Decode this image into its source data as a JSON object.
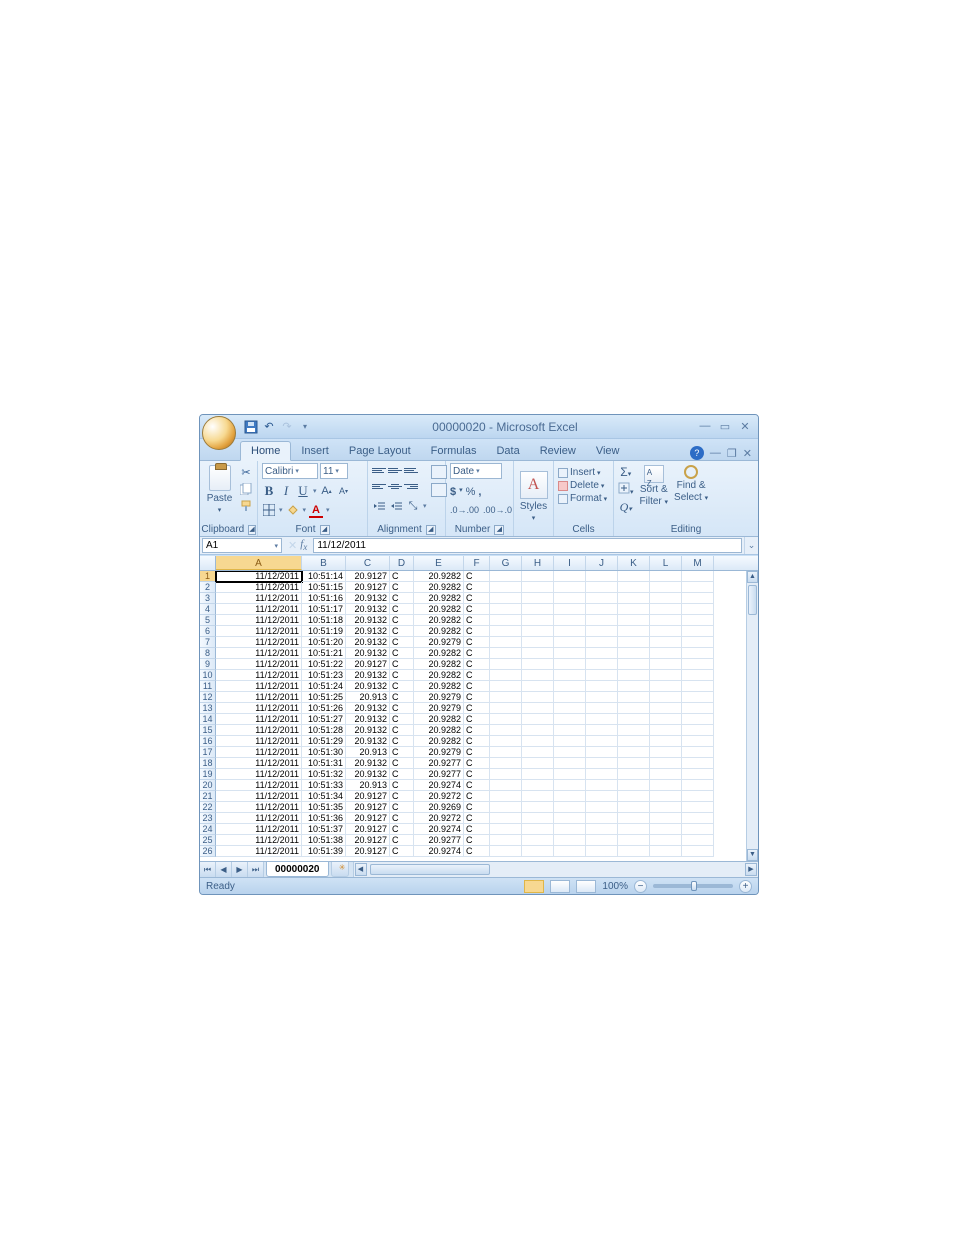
{
  "title": "00000020 - Microsoft Excel",
  "tabs": [
    "Home",
    "Insert",
    "Page Layout",
    "Formulas",
    "Data",
    "Review",
    "View"
  ],
  "activeTab": "Home",
  "ribbon": {
    "clipboard": {
      "label": "Clipboard",
      "paste": "Paste"
    },
    "font": {
      "label": "Font",
      "name": "Calibri",
      "size": "11"
    },
    "alignment": {
      "label": "Alignment"
    },
    "number": {
      "label": "Number",
      "format": "Date"
    },
    "styles": {
      "label": "Styles"
    },
    "cells": {
      "label": "Cells",
      "insert": "Insert",
      "delete": "Delete",
      "format": "Format"
    },
    "editing": {
      "label": "Editing",
      "sort": "Sort &",
      "filter": "Filter",
      "find": "Find &",
      "select": "Select"
    }
  },
  "nameBox": "A1",
  "formulaBar": "11/12/2011",
  "columns": [
    "A",
    "B",
    "C",
    "D",
    "E",
    "F",
    "G",
    "H",
    "I",
    "J",
    "K",
    "L",
    "M"
  ],
  "selectedColumn": "A",
  "rows": [
    {
      "n": 1,
      "a": "11/12/2011",
      "b": "10:51:14",
      "c": "20.9127",
      "d": "C",
      "e": "20.9282",
      "f": "C"
    },
    {
      "n": 2,
      "a": "11/12/2011",
      "b": "10:51:15",
      "c": "20.9127",
      "d": "C",
      "e": "20.9282",
      "f": "C"
    },
    {
      "n": 3,
      "a": "11/12/2011",
      "b": "10:51:16",
      "c": "20.9132",
      "d": "C",
      "e": "20.9282",
      "f": "C"
    },
    {
      "n": 4,
      "a": "11/12/2011",
      "b": "10:51:17",
      "c": "20.9132",
      "d": "C",
      "e": "20.9282",
      "f": "C"
    },
    {
      "n": 5,
      "a": "11/12/2011",
      "b": "10:51:18",
      "c": "20.9132",
      "d": "C",
      "e": "20.9282",
      "f": "C"
    },
    {
      "n": 6,
      "a": "11/12/2011",
      "b": "10:51:19",
      "c": "20.9132",
      "d": "C",
      "e": "20.9282",
      "f": "C"
    },
    {
      "n": 7,
      "a": "11/12/2011",
      "b": "10:51:20",
      "c": "20.9132",
      "d": "C",
      "e": "20.9279",
      "f": "C"
    },
    {
      "n": 8,
      "a": "11/12/2011",
      "b": "10:51:21",
      "c": "20.9132",
      "d": "C",
      "e": "20.9282",
      "f": "C"
    },
    {
      "n": 9,
      "a": "11/12/2011",
      "b": "10:51:22",
      "c": "20.9127",
      "d": "C",
      "e": "20.9282",
      "f": "C"
    },
    {
      "n": 10,
      "a": "11/12/2011",
      "b": "10:51:23",
      "c": "20.9132",
      "d": "C",
      "e": "20.9282",
      "f": "C"
    },
    {
      "n": 11,
      "a": "11/12/2011",
      "b": "10:51:24",
      "c": "20.9132",
      "d": "C",
      "e": "20.9282",
      "f": "C"
    },
    {
      "n": 12,
      "a": "11/12/2011",
      "b": "10:51:25",
      "c": "20.913",
      "d": "C",
      "e": "20.9279",
      "f": "C"
    },
    {
      "n": 13,
      "a": "11/12/2011",
      "b": "10:51:26",
      "c": "20.9132",
      "d": "C",
      "e": "20.9279",
      "f": "C"
    },
    {
      "n": 14,
      "a": "11/12/2011",
      "b": "10:51:27",
      "c": "20.9132",
      "d": "C",
      "e": "20.9282",
      "f": "C"
    },
    {
      "n": 15,
      "a": "11/12/2011",
      "b": "10:51:28",
      "c": "20.9132",
      "d": "C",
      "e": "20.9282",
      "f": "C"
    },
    {
      "n": 16,
      "a": "11/12/2011",
      "b": "10:51:29",
      "c": "20.9132",
      "d": "C",
      "e": "20.9282",
      "f": "C"
    },
    {
      "n": 17,
      "a": "11/12/2011",
      "b": "10:51:30",
      "c": "20.913",
      "d": "C",
      "e": "20.9279",
      "f": "C"
    },
    {
      "n": 18,
      "a": "11/12/2011",
      "b": "10:51:31",
      "c": "20.9132",
      "d": "C",
      "e": "20.9277",
      "f": "C"
    },
    {
      "n": 19,
      "a": "11/12/2011",
      "b": "10:51:32",
      "c": "20.9132",
      "d": "C",
      "e": "20.9277",
      "f": "C"
    },
    {
      "n": 20,
      "a": "11/12/2011",
      "b": "10:51:33",
      "c": "20.913",
      "d": "C",
      "e": "20.9274",
      "f": "C"
    },
    {
      "n": 21,
      "a": "11/12/2011",
      "b": "10:51:34",
      "c": "20.9127",
      "d": "C",
      "e": "20.9272",
      "f": "C"
    },
    {
      "n": 22,
      "a": "11/12/2011",
      "b": "10:51:35",
      "c": "20.9127",
      "d": "C",
      "e": "20.9269",
      "f": "C"
    },
    {
      "n": 23,
      "a": "11/12/2011",
      "b": "10:51:36",
      "c": "20.9127",
      "d": "C",
      "e": "20.9272",
      "f": "C"
    },
    {
      "n": 24,
      "a": "11/12/2011",
      "b": "10:51:37",
      "c": "20.9127",
      "d": "C",
      "e": "20.9274",
      "f": "C"
    },
    {
      "n": 25,
      "a": "11/12/2011",
      "b": "10:51:38",
      "c": "20.9127",
      "d": "C",
      "e": "20.9277",
      "f": "C"
    },
    {
      "n": 26,
      "a": "11/12/2011",
      "b": "10:51:39",
      "c": "20.9127",
      "d": "C",
      "e": "20.9274",
      "f": "C"
    }
  ],
  "sheetTab": "00000020",
  "status": {
    "ready": "Ready",
    "zoom": "100%"
  }
}
